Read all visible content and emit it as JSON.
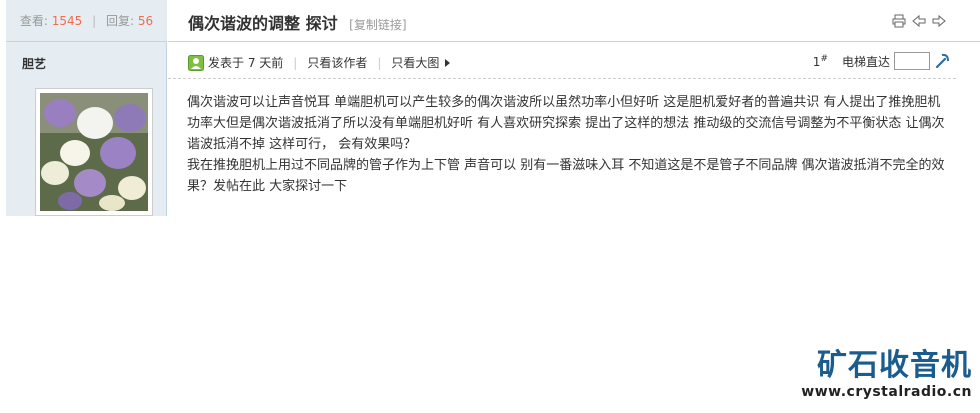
{
  "stats": {
    "views_label": "查看:",
    "views": "1545",
    "separator": "|",
    "replies_label": "回复:",
    "replies": "56"
  },
  "author": {
    "name": "胆艺"
  },
  "thread": {
    "title": "偶次谐波的调整 探讨",
    "copy_link": "[复制链接]",
    "icons": [
      "print-icon",
      "previous-thread-icon",
      "next-thread-icon"
    ]
  },
  "post_bar": {
    "posted": "发表于 7 天前",
    "author_only": "只看该作者",
    "large_image": "只看大图",
    "floor": "1",
    "floor_mark": "#",
    "elevator_label": "电梯直达",
    "elevator_value": ""
  },
  "content": {
    "p1": "偶次谐波可以让声音悦耳  单端胆机可以产生较多的偶次谐波所以虽然功率小但好听  这是胆机爱好者的普遍共识  有人提出了推挽胆机功率大但是偶次谐波抵消了所以没有单端胆机好听  有人喜欢研究探索  提出了这样的想法  推动级的交流信号调整为不平衡状态 让偶次谐波抵消不掉  这样可行，   会有效果吗？",
    "p2": "我在推挽胆机上用过不同品牌的管子作为上下管  声音可以  别有一番滋味入耳  不知道这是不是管子不同品牌 偶次谐波抵消不完全的效果？发帖在此  大家探讨一下"
  },
  "watermark": {
    "name": "矿石收音机",
    "url": "www.crystalradio.cn",
    "color": "#1b5c8e"
  }
}
